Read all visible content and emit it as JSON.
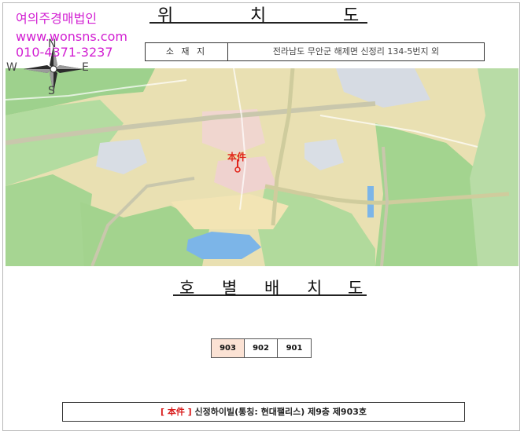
{
  "brand": {
    "name": "여의주경매법인",
    "url": "www.wonsns.com",
    "phone": "010-4371-3237"
  },
  "location_title": {
    "chars": [
      "위",
      "치",
      "도"
    ]
  },
  "location_table": {
    "label": "소 재 지",
    "value": "전라남도 무안군 해제면 신정리 134-5번지 외"
  },
  "map": {
    "marker_label": "本件",
    "colors": {
      "land": "#ece3b3",
      "green": "#a7d591",
      "water": "#7cb5e8",
      "road": "#c6c6aa",
      "marker": "#e2251b"
    }
  },
  "compass": {
    "n": "N",
    "e": "E",
    "s": "S",
    "w": "W"
  },
  "unit_title": {
    "chars": [
      "호",
      "별",
      "배",
      "치",
      "도"
    ]
  },
  "units": [
    {
      "label": "903",
      "active": true
    },
    {
      "label": "902",
      "active": false
    },
    {
      "label": "901",
      "active": false
    }
  ],
  "summary": {
    "tag": "[ 本件 ]",
    "text": " 신정하이빌(통칭: 현대팰리스) 제9층 제903호"
  }
}
